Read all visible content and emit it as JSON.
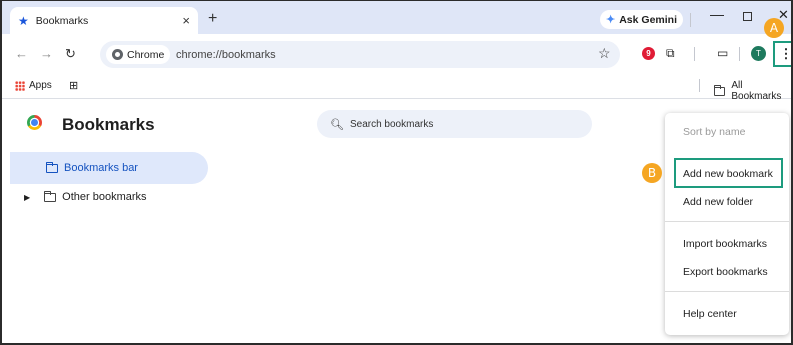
{
  "tab": {
    "title": "Bookmarks",
    "close": "×"
  },
  "newtab_label": "+",
  "gemini": {
    "label": "Ask Gemini"
  },
  "window": {
    "minimize": "—",
    "close": "✕"
  },
  "address": {
    "chip": "Chrome",
    "url": "chrome://bookmarks"
  },
  "avatar_letter": "T",
  "ext_letter": "9",
  "bookmarks_bar": {
    "apps": "Apps",
    "all_bookmarks": "All Bookmarks"
  },
  "page": {
    "title": "Bookmarks",
    "search_placeholder": "Search bookmarks"
  },
  "sidebar": {
    "items": [
      {
        "label": "Bookmarks bar",
        "selected": true
      },
      {
        "label": "Other bookmarks",
        "selected": false
      }
    ]
  },
  "menu": {
    "sort": "Sort by name",
    "add_bookmark": "Add new bookmark",
    "add_folder": "Add new folder",
    "import": "Import bookmarks",
    "export": "Export bookmarks",
    "help": "Help center"
  },
  "badges": {
    "a": "A",
    "b": "B"
  },
  "colors": {
    "accent": "#1553c0",
    "highlight": "#1d9b7e",
    "badge": "#f5a623"
  }
}
